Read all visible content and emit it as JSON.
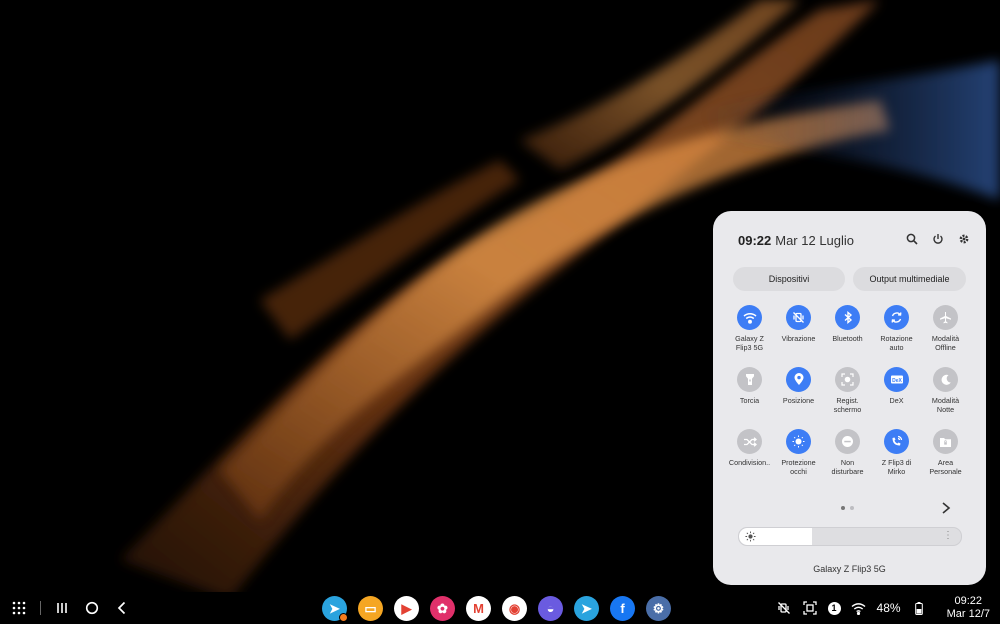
{
  "colors": {
    "accent": "#3d7df5",
    "panel_bg": "#e9e9ec",
    "tile_off": "#c3c3c7"
  },
  "quick_panel": {
    "time": "09:22",
    "date": "Mar 12 Luglio",
    "icons": [
      "search-icon",
      "power-icon",
      "gear-icon"
    ],
    "devices_label": "Dispositivi",
    "media_output_label": "Output multimediale",
    "tiles": [
      {
        "label": "Galaxy Z\nFlip3 5G",
        "icon": "wifi-icon",
        "on": true
      },
      {
        "label": "Vibrazione",
        "icon": "vibration-icon",
        "on": true
      },
      {
        "label": "Bluetooth",
        "icon": "bluetooth-icon",
        "on": true
      },
      {
        "label": "Rotazione\nauto",
        "icon": "rotation-icon",
        "on": true
      },
      {
        "label": "Modalità\nOffline",
        "icon": "airplane-icon",
        "on": false
      },
      {
        "label": "Torcia",
        "icon": "flashlight-icon",
        "on": false
      },
      {
        "label": "Posizione",
        "icon": "location-icon",
        "on": true
      },
      {
        "label": "Regist.\nschermo",
        "icon": "screen-record-icon",
        "on": false
      },
      {
        "label": "DeX",
        "icon": "dex-icon",
        "on": true
      },
      {
        "label": "Modalità\nNotte",
        "icon": "moon-icon",
        "on": false
      },
      {
        "label": "Condivision..",
        "icon": "share-icon",
        "on": false
      },
      {
        "label": "Protezione\nocchi",
        "icon": "eye-comfort-icon",
        "on": true
      },
      {
        "label": "Non\ndisturbare",
        "icon": "dnd-icon",
        "on": false
      },
      {
        "label": "Z Flip3 di\nMirko",
        "icon": "phone-link-icon",
        "on": true
      },
      {
        "label": "Area\nPersonale",
        "icon": "secure-folder-icon",
        "on": false
      }
    ],
    "page_count": 2,
    "page_active": 1,
    "brightness": 0.33,
    "device_name": "Galaxy Z Flip3 5G"
  },
  "taskbar": {
    "apps": [
      {
        "name": "telegram-app",
        "color": "#2aa3de",
        "glyph": "➤",
        "dot": true
      },
      {
        "name": "samsung-notes-app",
        "color": "#f5a623",
        "glyph": "▭"
      },
      {
        "name": "play-store-app",
        "color": "#ffffff",
        "glyph": "▶"
      },
      {
        "name": "gallery-app",
        "color": "#e0306a",
        "glyph": "✿"
      },
      {
        "name": "gmail-app",
        "color": "#ffffff",
        "glyph": "M"
      },
      {
        "name": "chrome-app",
        "color": "#ffffff",
        "glyph": "◉"
      },
      {
        "name": "samsung-internet-app",
        "color": "#6a5be0",
        "glyph": "◒"
      },
      {
        "name": "telegram-app-2",
        "color": "#2aa3de",
        "glyph": "➤"
      },
      {
        "name": "facebook-app",
        "color": "#1877f2",
        "glyph": "f"
      },
      {
        "name": "settings-app",
        "color": "#4a6ea8",
        "glyph": "⚙"
      }
    ],
    "notification_count": "1",
    "battery": "48%",
    "clock_time": "09:22",
    "clock_date": "Mar 12/7"
  }
}
